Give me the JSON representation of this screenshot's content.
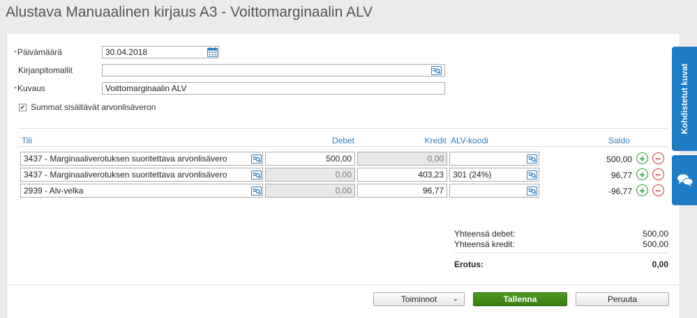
{
  "page": {
    "title": "Alustava Manuaalinen kirjaus A3  -  Voittomarginaalin ALV"
  },
  "form": {
    "required_mark": "*",
    "date_label": "Päivämäärä",
    "date_value": "30.04.2018",
    "template_label": "Kirjanpitomallit",
    "template_value": "",
    "description_label": "Kuvaus",
    "description_value": "Voittomarginaalin ALV",
    "vat_checkbox_label": "Summat sisältävät arvonlisäveron",
    "vat_checkbox_checked": true
  },
  "table": {
    "headers": {
      "account": "Tili",
      "debit": "Debet",
      "credit": "Kredit",
      "vat_code": "ALV-koodi",
      "balance": "Saldo"
    },
    "rows": [
      {
        "account": "3437 - Marginaaliverotuksen suoritettava arvonlisävero",
        "debit": "500,00",
        "credit": "0,00",
        "vat_code": "",
        "balance": "500,00"
      },
      {
        "account": "3437 - Marginaaliverotuksen suoritettava arvonlisävero",
        "debit": "0,00",
        "credit": "403,23",
        "vat_code": "301 (24%)",
        "balance": "96,77"
      },
      {
        "account": "2939 - Alv-velka",
        "debit": "0,00",
        "credit": "96,77",
        "vat_code": "",
        "balance": "-96,77"
      }
    ],
    "add_symbol": "+",
    "remove_symbol": "−"
  },
  "totals": {
    "debit_label": "Yhteensä debet:",
    "debit_value": "500,00",
    "credit_label": "Yhteensä kredit:",
    "credit_value": "500,00",
    "difference_label": "Erotus:",
    "difference_value": "0,00"
  },
  "footer": {
    "actions_label": "Toiminnot",
    "save_label": "Tallenna",
    "cancel_label": "Peruuta"
  },
  "side": {
    "attached_images_label": "Kohdistetut kuvat"
  },
  "icons": {
    "calendar": "calendar-icon",
    "lookup": "lookup-icon",
    "chevron": "chevron-down-icon",
    "chat": "chat-icon"
  },
  "colors": {
    "accent": "#1e7bc6",
    "save": "#3f8a18",
    "add": "#2e9e3a",
    "remove": "#d0363b",
    "required": "#c0392b"
  }
}
